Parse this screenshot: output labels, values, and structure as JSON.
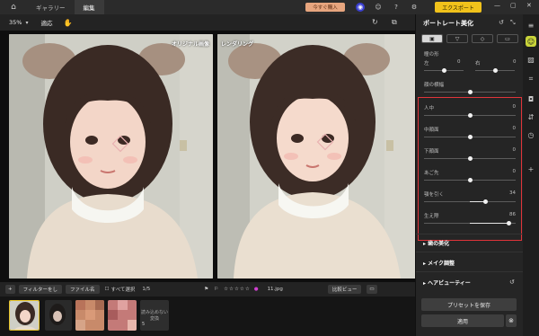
{
  "topbar": {
    "tabs": [
      "ギャラリー",
      "編集"
    ],
    "buy_label": "今すぐ購入",
    "export_label": "エクスポート"
  },
  "toolbar": {
    "zoom": "35%",
    "apply_label": "適応"
  },
  "canvas": {
    "left_label": "オリジナル画像",
    "right_label": "レンダリング"
  },
  "bottombar": {
    "filter_label": "フィルターをし",
    "filename_label": "ファイル名",
    "select_all_label": "すべて選択",
    "page_count": "1/5",
    "file_name": "11.jpg",
    "compare_label": "比較ビュー"
  },
  "filmstrip": {
    "unreadable_note": "読み込めない変換",
    "count": "5"
  },
  "panel": {
    "title": "ポートレート美化",
    "top_sliders": [
      {
        "label": "瞳の形",
        "left": "左",
        "left_value": "0",
        "right": "右",
        "right_value": "0"
      },
      {
        "label": "顔の横幅",
        "value": ""
      }
    ],
    "sliders": [
      {
        "label": "人中",
        "value": "0",
        "level": 0.5
      },
      {
        "label": "中顔面",
        "value": "0",
        "level": 0.5
      },
      {
        "label": "下顔面",
        "value": "0",
        "level": 0.5
      },
      {
        "label": "あご先",
        "value": "0",
        "level": 0.5
      },
      {
        "label": "顎を引く",
        "value": "34",
        "level": 0.67
      },
      {
        "label": "生え際",
        "value": "86",
        "level": 0.93
      }
    ],
    "sections": [
      "歯の美化",
      "メイク調整",
      "ヘアビューティー"
    ],
    "save_preset_label": "プリセットを保存",
    "apply_label": "適用"
  },
  "colors": {
    "accent_export": "#f1c21b",
    "highlight": "#e0343a",
    "rail_active": "#c9d43a"
  }
}
